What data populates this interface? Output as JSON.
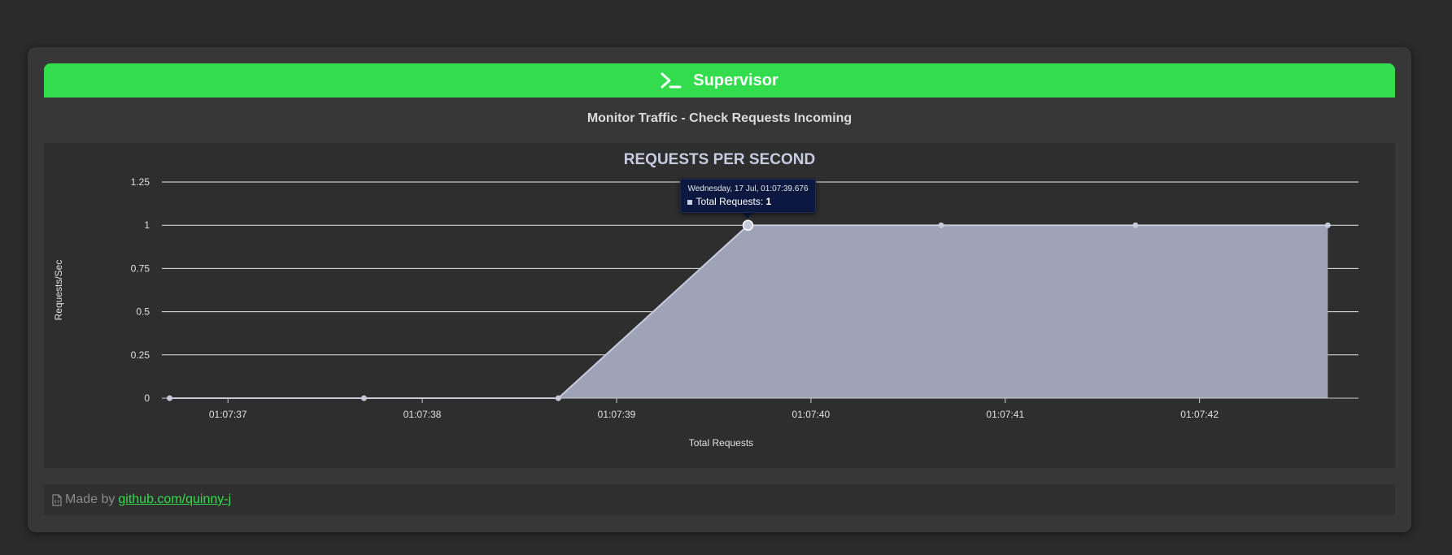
{
  "header": {
    "title": "Supervisor",
    "icon": "terminal-icon",
    "color": "#32dc4c"
  },
  "subtitle": "Monitor Traffic - Check Requests Incoming",
  "tooltip": {
    "date": "Wednesday, 17 Jul, 01:07:39.676",
    "series_label": "Total Requests: ",
    "value": "1"
  },
  "footer": {
    "icon": "file-code-icon",
    "prefix": "Made by",
    "link_text": "github.com/quinny-j"
  },
  "chart_data": {
    "type": "area",
    "title": "REQUESTS PER SECOND",
    "xlabel": "Total Requests",
    "ylabel": "Requests/Sec",
    "ylim": [
      0,
      1.25
    ],
    "yticks": [
      "0",
      "0.25",
      "0.5",
      "0.75",
      "1",
      "1.25"
    ],
    "ytick_values": [
      0,
      0.25,
      0.5,
      0.75,
      1,
      1.25
    ],
    "xticks": [
      "01:07:37",
      "01:07:38",
      "01:07:39",
      "01:07:40",
      "01:07:41",
      "01:07:42"
    ],
    "xtick_values": [
      37,
      38,
      39,
      40,
      41,
      42
    ],
    "xlim": [
      36.66,
      42.78
    ],
    "series": [
      {
        "x": [
          36.7,
          37.7,
          38.7,
          39.676,
          40.67,
          41.67,
          42.66
        ],
        "y": [
          0,
          0,
          0,
          1,
          1,
          1,
          1
        ]
      }
    ],
    "grid": true,
    "fill_color": "#9fa3b7",
    "line_color": "#c6cadb"
  }
}
